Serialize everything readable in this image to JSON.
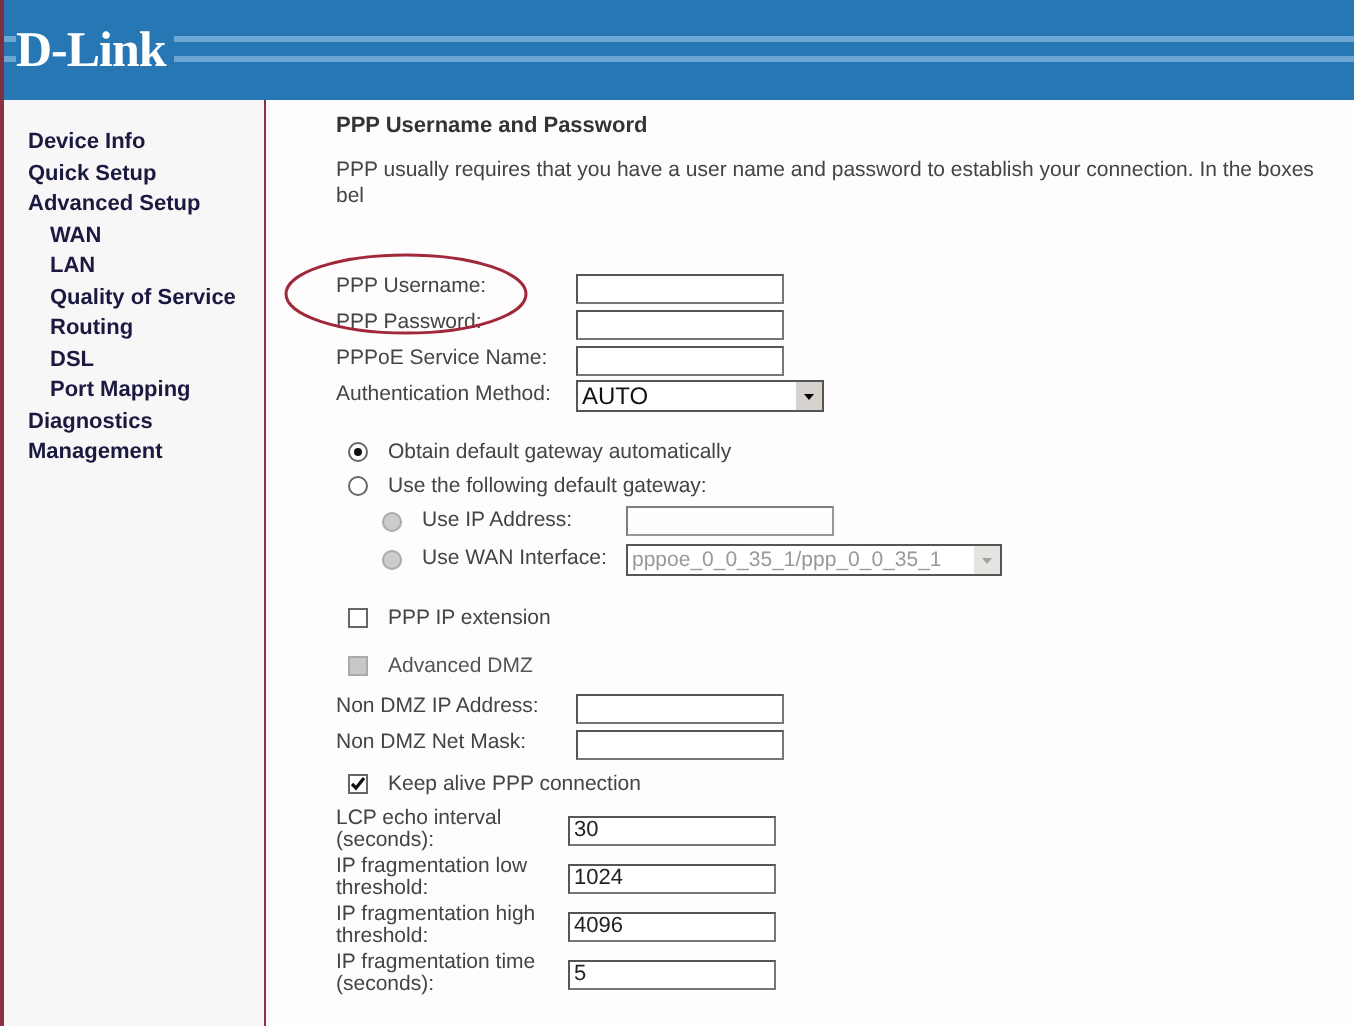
{
  "logo": "D-Link",
  "sidebar": {
    "items": [
      {
        "label": "Device Info"
      },
      {
        "label": "Quick Setup"
      },
      {
        "label": "Advanced Setup",
        "children": [
          {
            "label": "WAN"
          },
          {
            "label": "LAN"
          },
          {
            "label": "Quality of Service"
          },
          {
            "label": "Routing"
          },
          {
            "label": "DSL"
          },
          {
            "label": "Port Mapping"
          }
        ]
      },
      {
        "label": "Diagnostics"
      },
      {
        "label": "Management"
      }
    ]
  },
  "page": {
    "title": "PPP Username and Password",
    "description": "PPP usually requires that you have a user name and password to establish your connection. In the boxes bel"
  },
  "credentials": [
    {
      "label": "PPP Username:",
      "kind": "text"
    },
    {
      "label": "PPP Password:",
      "kind": "text"
    }
  ],
  "fields": [
    {
      "label": "PPPoE Service Name:",
      "kind": "text"
    },
    {
      "label": "Authentication Method:",
      "kind": "select",
      "value": "AUTO"
    }
  ],
  "gateway": [
    {
      "label": "Obtain default gateway automatically",
      "selected": true
    },
    {
      "label": "Use the following default gateway:",
      "selected": false,
      "children": [
        {
          "label": "Use IP Address:",
          "selected": false,
          "disabled": true,
          "kind": "text"
        },
        {
          "label": "Use WAN Interface:",
          "selected": false,
          "disabled": true,
          "kind": "select",
          "value": "pppoe_0_0_35_1/ppp_0_0_35_1"
        }
      ]
    }
  ],
  "ppp_ip_extension": {
    "label": "PPP IP extension",
    "checked": false,
    "disabled": false
  },
  "advanced_dmz": {
    "label": "Advanced DMZ",
    "checked": false,
    "disabled": true
  },
  "dmz_fields": [
    {
      "label": "Non DMZ IP Address:",
      "kind": "text"
    },
    {
      "label": "Non DMZ Net Mask:",
      "kind": "text"
    }
  ],
  "keep_alive": {
    "label": "Keep alive PPP connection",
    "checked": true,
    "disabled": false
  },
  "advanced_fields": [
    {
      "label": "LCP echo interval (seconds):",
      "kind": "text",
      "value": "30"
    },
    {
      "label": "IP fragmentation low threshold:",
      "kind": "text",
      "value": "1024"
    },
    {
      "label": "IP fragmentation high threshold:",
      "kind": "text",
      "value": "4096"
    },
    {
      "label": "IP fragmentation time (seconds):",
      "kind": "text",
      "value": "5"
    }
  ]
}
